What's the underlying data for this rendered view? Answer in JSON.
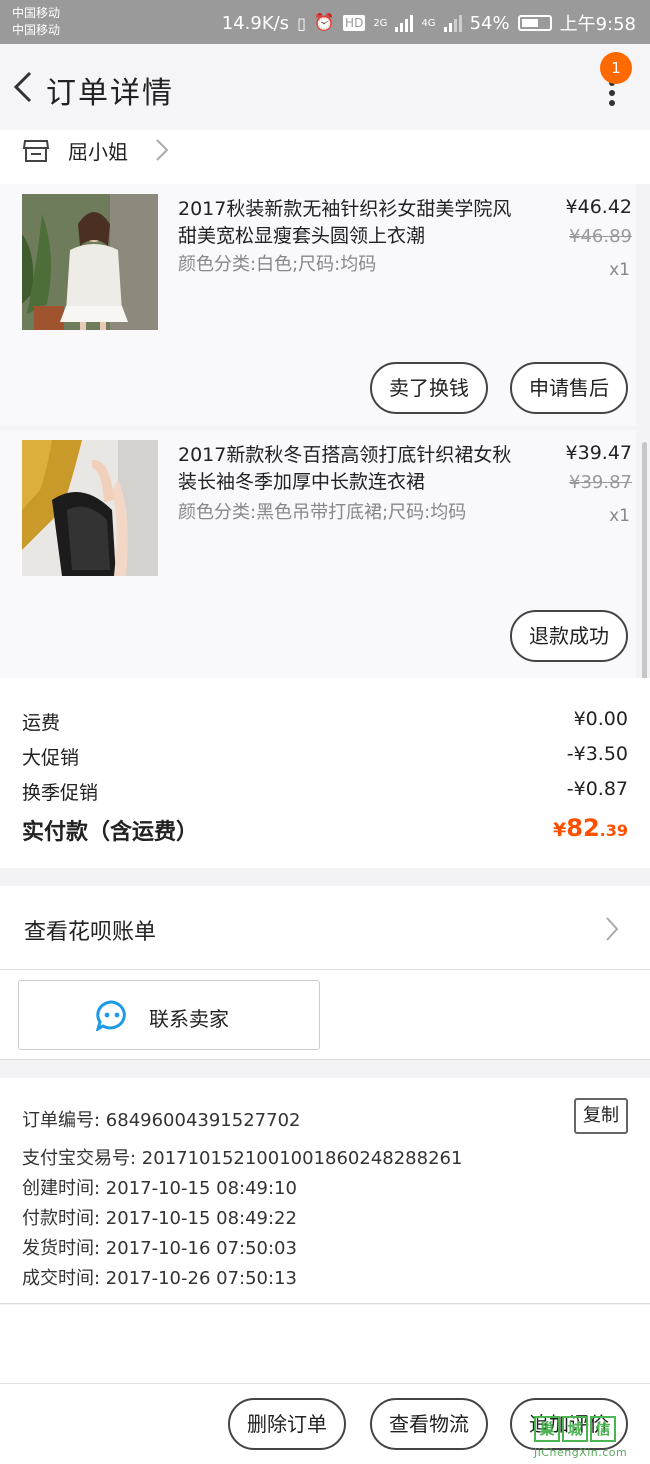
{
  "status_bar": {
    "carrier_1": "中国移动",
    "carrier_2": "中国移动",
    "speed": "14.9K/s",
    "hd": "HD",
    "net_2g": "2G",
    "net_4g": "4G",
    "battery": "54%",
    "time": "上午9:58"
  },
  "nav": {
    "back_icon": "chevron-left-icon",
    "title": "订单详情",
    "badge": "1",
    "more_icon": "more-vertical-icon"
  },
  "shop": {
    "name": "屈小姐",
    "icon": "store-icon"
  },
  "items": [
    {
      "title": "2017秋装新款无袖针织衫女甜美学院风甜美宽松显瘦套头圆领上衣潮",
      "spec": "颜色分类:白色;尺码:均码",
      "price": "¥46.42",
      "original_price": "¥46.89",
      "qty": "x1",
      "buttons": [
        "卖了换钱",
        "申请售后"
      ]
    },
    {
      "title": "2017新款秋冬百搭高领打底针织裙女秋装长袖冬季加厚中长款连衣裙",
      "spec": "颜色分类:黑色吊带打底裙;尺码:均码",
      "price": "¥39.47",
      "original_price": "¥39.87",
      "qty": "x1",
      "buttons": [
        "退款成功"
      ]
    }
  ],
  "summary": {
    "shipping_label": "运费",
    "shipping_value": "¥0.00",
    "promo_label": "大促销",
    "promo_value": "-¥3.50",
    "season_label": "换季促销",
    "season_value": "-¥0.87",
    "total_label": "实付款（含运费）",
    "total_currency": "¥",
    "total_main": "82",
    "total_decimal": ".39"
  },
  "huabei": {
    "label": "查看花呗账单"
  },
  "contact": {
    "label": "联系卖家",
    "icon": "chat-bubble-icon"
  },
  "order_info": {
    "order_no": "订单编号: 68496004391527702",
    "alipay_no": "支付宝交易号: 2017101521001001860248288261",
    "created": "创建时间: 2017-10-15 08:49:10",
    "paid": "付款时间: 2017-10-15 08:49:22",
    "shipped": "发货时间: 2017-10-16 07:50:03",
    "completed": "成交时间: 2017-10-26 07:50:13",
    "copy_label": "复制"
  },
  "actions": [
    "删除订单",
    "查看物流",
    "追加评价"
  ],
  "watermark": {
    "chars": [
      "巢",
      "城",
      "信"
    ],
    "url": "JiChengXin.com"
  },
  "colors": {
    "accent": "#ff5000",
    "badge": "#ff6a00",
    "status_bar": "#9a9a9a"
  }
}
